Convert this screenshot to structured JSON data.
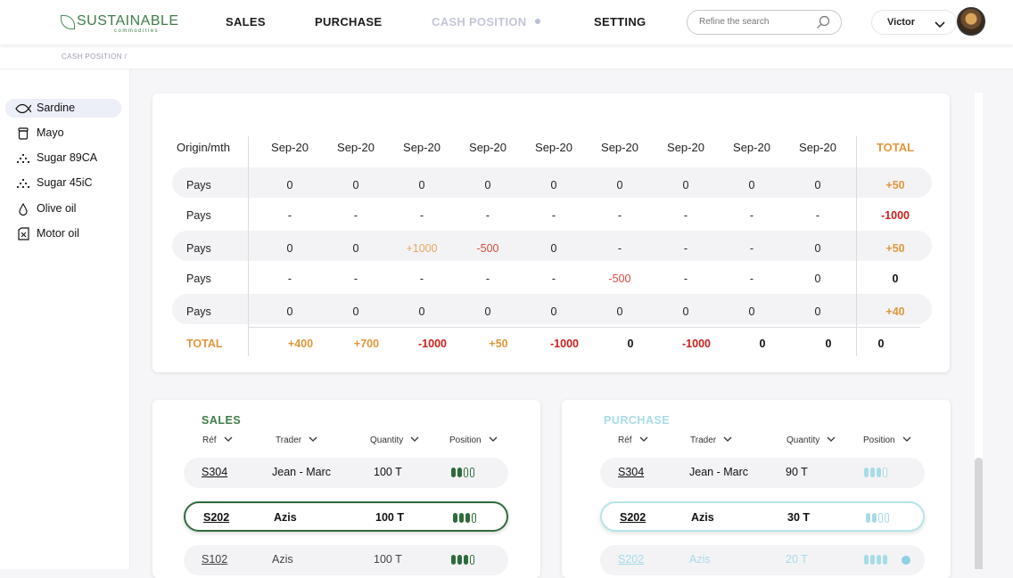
{
  "header": {
    "brand": "SUSTAINABLE",
    "brand_sub": "commodities",
    "nav": [
      {
        "label": "SALES",
        "active": false
      },
      {
        "label": "PURCHASE",
        "active": false
      },
      {
        "label": "CASH POSITION",
        "active": true
      },
      {
        "label": "SETTING",
        "active": false
      }
    ],
    "search_placeholder": "Refine the search",
    "user_name": "Victor"
  },
  "breadcrumb": "CASH POSITION /",
  "sidebar": {
    "items": [
      {
        "label": "Sardine",
        "icon": "fish-icon",
        "active": true
      },
      {
        "label": "Mayo",
        "icon": "jar-icon",
        "active": false
      },
      {
        "label": "Sugar 89CA",
        "icon": "grain-icon",
        "active": false
      },
      {
        "label": "Sugar 45iC",
        "icon": "grain-icon",
        "active": false
      },
      {
        "label": "Olive oil",
        "icon": "drop-icon",
        "active": false
      },
      {
        "label": "Motor oil",
        "icon": "canister-icon",
        "active": false
      }
    ]
  },
  "cash_table": {
    "corner": "Origin/mth",
    "months": [
      "Sep-20",
      "Sep-20",
      "Sep-20",
      "Sep-20",
      "Sep-20",
      "Sep-20",
      "Sep-20",
      "Sep-20",
      "Sep-20"
    ],
    "total_label": "TOTAL",
    "rows": [
      {
        "label": "Pays",
        "values": [
          "0",
          "0",
          "0",
          "0",
          "0",
          "0",
          "0",
          "0",
          "0"
        ],
        "total": "+50"
      },
      {
        "label": "Pays",
        "values": [
          "-",
          "-",
          "-",
          "-",
          "-",
          "-",
          "-",
          "-",
          "-"
        ],
        "total": "-1000"
      },
      {
        "label": "Pays",
        "values": [
          "0",
          "0",
          "+1000",
          "-500",
          "0",
          "-",
          "-",
          "-",
          "0"
        ],
        "total": "+50"
      },
      {
        "label": "Pays",
        "values": [
          "-",
          "-",
          "-",
          "-",
          "-",
          "-500",
          "-",
          "-",
          "0"
        ],
        "total": "0"
      },
      {
        "label": "Pays",
        "values": [
          "0",
          "0",
          "0",
          "0",
          "0",
          "0",
          "0",
          "0",
          "0"
        ],
        "total": "+40"
      }
    ],
    "totals_row_label": "TOTAL",
    "totals": [
      "+400",
      "+700",
      "-1000",
      "+50",
      "-1000",
      "0",
      "-1000",
      "0",
      "0"
    ],
    "grand_total": "0"
  },
  "sales": {
    "title": "SALES",
    "columns": [
      "Réf",
      "Trader",
      "Quantity",
      "Position"
    ],
    "rows": [
      {
        "ref": "S304",
        "trader": "Jean - Marc",
        "quantity": "100 T",
        "position": 2,
        "selected": false
      },
      {
        "ref": "S202",
        "trader": "Azis",
        "quantity": "100 T",
        "position": 3,
        "selected": true
      },
      {
        "ref": "S102",
        "trader": "Azis",
        "quantity": "100 T",
        "position": 3,
        "selected": false
      }
    ]
  },
  "purchase": {
    "title": "PURCHASE",
    "columns": [
      "Réf",
      "Trader",
      "Quantity",
      "Position"
    ],
    "rows": [
      {
        "ref": "S304",
        "trader": "Jean - Marc",
        "quantity": "90 T",
        "position": 3,
        "selected": false
      },
      {
        "ref": "S202",
        "trader": "Azis",
        "quantity": "30 T",
        "position": 2,
        "selected": true
      },
      {
        "ref": "S202",
        "trader": "Azis",
        "quantity": "20 T",
        "position": 4,
        "selected": false,
        "checked": true
      }
    ]
  },
  "colors": {
    "brand_green": "#3d7d4a",
    "positive": "#e0963a",
    "negative": "#c8201c",
    "purchase_accent": "#8fcfe0",
    "nav_active": "#c2c6d6"
  }
}
